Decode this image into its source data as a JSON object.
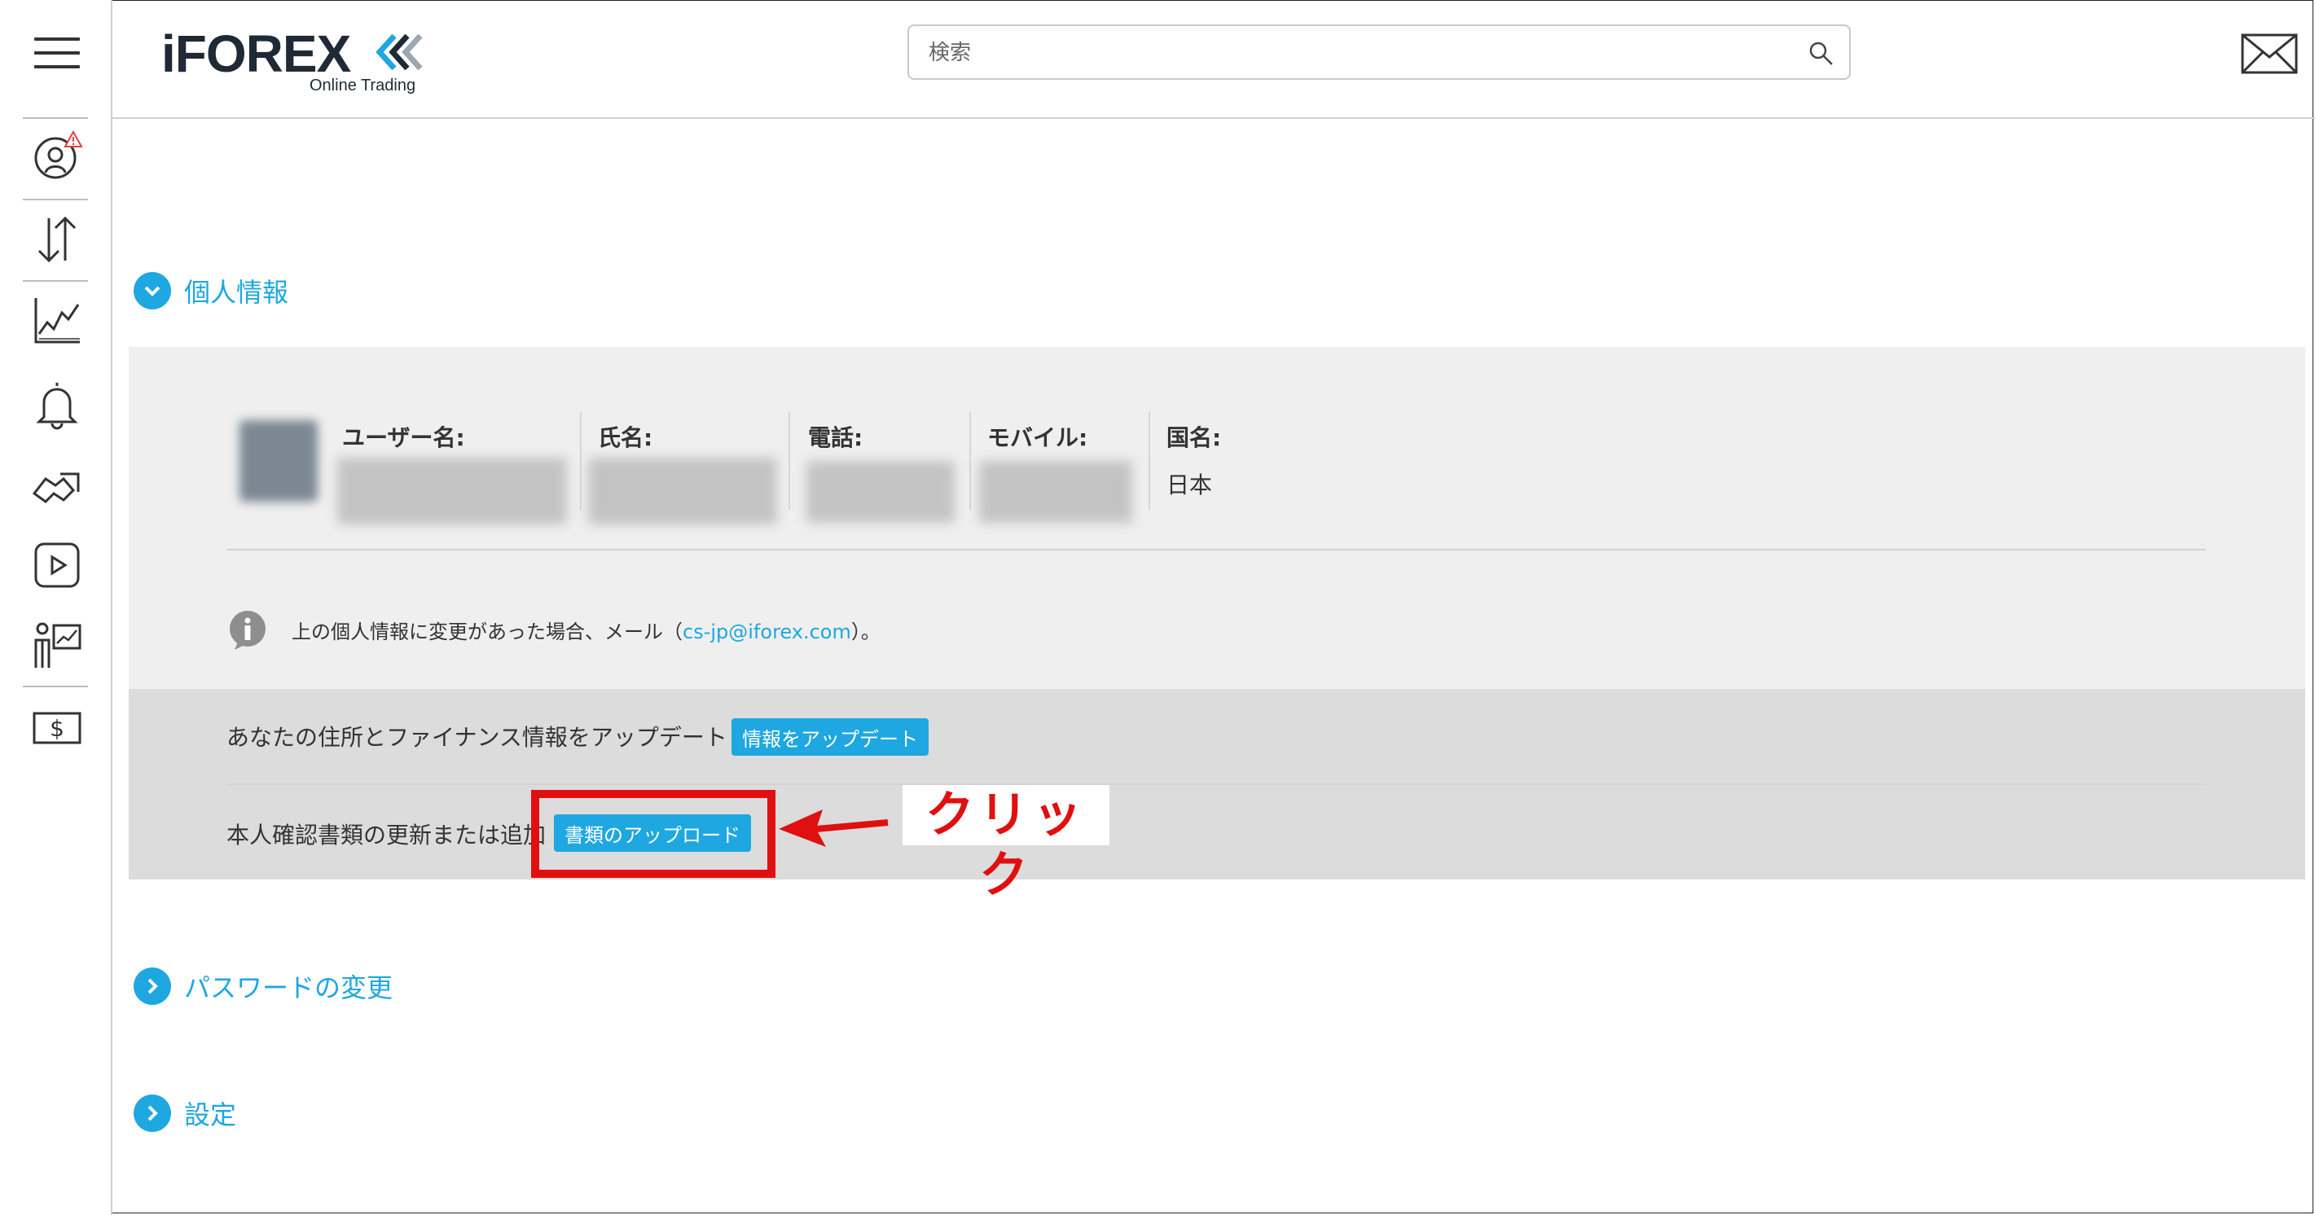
{
  "header": {
    "logo_text": "iFOREX",
    "logo_sub": "Online Trading",
    "search_placeholder": "検索"
  },
  "sidebar": {
    "icons": [
      "menu-icon",
      "profile-warning-icon",
      "transfer-arrows-icon",
      "chart-icon",
      "bell-icon",
      "handshake-icon",
      "play-video-icon",
      "education-chart-icon",
      "dollar-bill-icon"
    ]
  },
  "sections": {
    "personal_info": "個人情報",
    "password_change": "パスワードの変更",
    "settings": "設定"
  },
  "personal": {
    "username_label": "ユーザー名:",
    "name_label": "氏名:",
    "phone_label": "電話:",
    "mobile_label": "モバイル:",
    "country_label": "国名:",
    "country_value": "日本"
  },
  "info": {
    "text_before": "上の個人情報に変更があった場合、メール（",
    "email": "cs-jp@iforex.com",
    "text_after": "）。"
  },
  "updates": {
    "address_text": "あなたの住所とファイナンス情報をアップデート",
    "address_button": "情報をアップデート",
    "docs_text": "本人確認書類の更新または追加",
    "docs_button": "書類のアップロード"
  },
  "annotation": {
    "click_label": "クリック",
    "color": "#e01010"
  },
  "colors": {
    "accent": "#1ea7e1",
    "annotation_red": "#e01010"
  }
}
